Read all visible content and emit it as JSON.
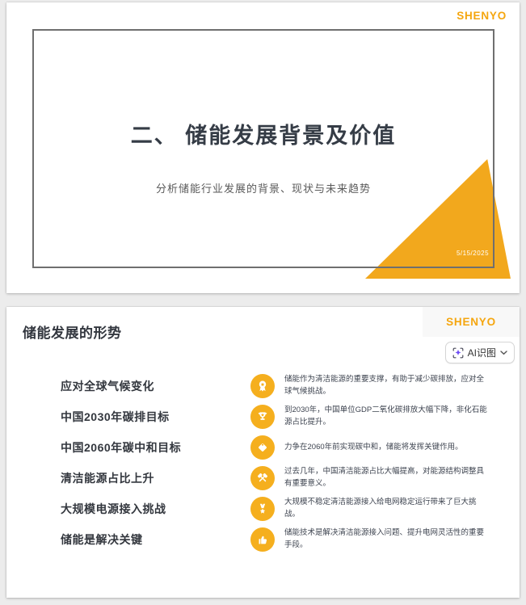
{
  "colors": {
    "accent_orange": "#F5A60F",
    "triangle_orange": "#F2A81D",
    "icon_orange": "#F5AF1E",
    "ai_icon_purple": "#6E4DF5",
    "title_dark": "#353C46"
  },
  "slide1": {
    "logo": "SHENYO",
    "title": "二、 储能发展背景及价值",
    "subtitle": "分析储能行业发展的背景、现状与未来趋势",
    "date": "5/15/2025"
  },
  "slide2": {
    "logo": "SHENYO",
    "title": "储能发展的形势",
    "ai_button": {
      "label": "AI识图",
      "icon": "ai-scan-sparkle-icon"
    },
    "rows": [
      {
        "icon": "medal-icon",
        "label": "应对全球气候变化",
        "desc": "储能作为清洁能源的重要支撑，有助于减少碳排放，应对全球气候挑战。"
      },
      {
        "icon": "trophy-icon",
        "label": "中国2030年碳排目标",
        "desc": "到2030年，中国单位GDP二氧化碳排放大幅下降，非化石能源占比提升。"
      },
      {
        "icon": "tag-icon",
        "label": "中国2060年碳中和目标",
        "desc": "力争在2060年前实现碳中和，储能将发挥关键作用。"
      },
      {
        "icon": "crossed-mallets-icon",
        "label": "清洁能源占比上升",
        "desc": "过去几年，中国清洁能源占比大幅提高，对能源结构调整具有重要意义。"
      },
      {
        "icon": "star-badge-icon",
        "label": "大规模电源接入挑战",
        "desc": "大规模不稳定清洁能源接入给电网稳定运行带来了巨大挑战。"
      },
      {
        "icon": "thumbs-up-icon",
        "label": "储能是解决关键",
        "desc": "储能技术是解决清洁能源接入问题、提升电网灵活性的重要手段。"
      }
    ]
  }
}
